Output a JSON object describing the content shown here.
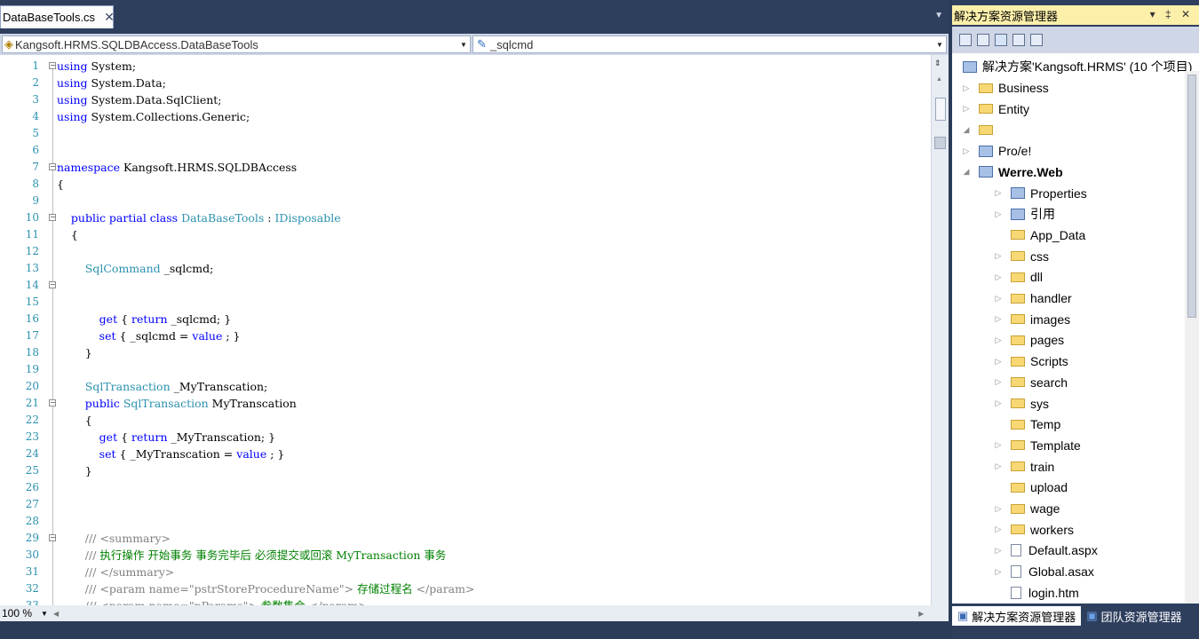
{
  "editor": {
    "tab_title": "DataBaseTools.cs",
    "tab_close": "✕",
    "type_combo": "Kangsoft.HRMS.SQLDBAccess.DataBaseTools",
    "member_combo": "_sqlcmd",
    "zoom": "100 %",
    "lines": [
      {
        "n": "1",
        "parts": [
          [
            "kw",
            "using"
          ],
          [
            "",
            "System;"
          ]
        ],
        "fold": "−"
      },
      {
        "n": "2",
        "parts": [
          [
            "kw",
            "using"
          ],
          [
            "",
            "System.Data;"
          ]
        ]
      },
      {
        "n": "3",
        "parts": [
          [
            "kw",
            "using"
          ],
          [
            "",
            "System.Data.SqlClient;"
          ]
        ]
      },
      {
        "n": "4",
        "parts": [
          [
            "kw",
            "using"
          ],
          [
            "",
            "System.Collections.Generic;"
          ]
        ]
      },
      {
        "n": "5",
        "parts": []
      },
      {
        "n": "6",
        "parts": []
      },
      {
        "n": "7",
        "parts": [
          [
            "kw",
            "namespace"
          ],
          [
            "",
            "Kangsoft.HRMS.SQLDBAccess"
          ]
        ],
        "fold": "−"
      },
      {
        "n": "8",
        "parts": [
          [
            "",
            "{"
          ]
        ]
      },
      {
        "n": "9",
        "parts": []
      },
      {
        "n": "10",
        "parts": [
          [
            "kw",
            "    public partial class"
          ],
          [
            "ty",
            "DataBaseTools"
          ],
          [
            "",
            ":"
          ],
          [
            "ty",
            "IDisposable"
          ]
        ],
        "fold": "−"
      },
      {
        "n": "11",
        "parts": [
          [
            "",
            "    {"
          ]
        ]
      },
      {
        "n": "12",
        "parts": []
      },
      {
        "n": "13",
        "parts": [
          [
            "ty",
            "        SqlCommand"
          ],
          [
            "",
            "_sqlcmd;"
          ]
        ]
      },
      {
        "n": "14",
        "parts": [],
        "fold": "−"
      },
      {
        "n": "15",
        "parts": []
      },
      {
        "n": "16",
        "parts": [
          [
            "kw",
            "            get"
          ],
          [
            "",
            "{"
          ],
          [
            "kw",
            "return"
          ],
          [
            "",
            "_sqlcmd; }"
          ]
        ]
      },
      {
        "n": "17",
        "parts": [
          [
            "kw",
            "            set"
          ],
          [
            "",
            "{ _sqlcmd ="
          ],
          [
            "kw",
            "value"
          ],
          [
            "",
            "; }"
          ]
        ]
      },
      {
        "n": "18",
        "parts": [
          [
            "",
            "        }"
          ]
        ]
      },
      {
        "n": "19",
        "parts": []
      },
      {
        "n": "20",
        "parts": [
          [
            "ty",
            "        SqlTransaction"
          ],
          [
            "",
            "_MyTranscation;"
          ]
        ]
      },
      {
        "n": "21",
        "parts": [
          [
            "kw",
            "        public"
          ],
          [
            "ty",
            "SqlTransaction"
          ],
          [
            "",
            "MyTranscation"
          ]
        ],
        "fold": "−"
      },
      {
        "n": "22",
        "parts": [
          [
            "",
            "        {"
          ]
        ]
      },
      {
        "n": "23",
        "parts": [
          [
            "kw",
            "            get"
          ],
          [
            "",
            "{"
          ],
          [
            "kw",
            "return"
          ],
          [
            "",
            "_MyTranscation; }"
          ]
        ]
      },
      {
        "n": "24",
        "parts": [
          [
            "kw",
            "            set"
          ],
          [
            "",
            "{ _MyTranscation ="
          ],
          [
            "kw",
            "value"
          ],
          [
            "",
            "; }"
          ]
        ]
      },
      {
        "n": "25",
        "parts": [
          [
            "",
            "        }"
          ]
        ]
      },
      {
        "n": "26",
        "parts": []
      },
      {
        "n": "27",
        "parts": []
      },
      {
        "n": "28",
        "parts": []
      },
      {
        "n": "29",
        "parts": [
          [
            "dc",
            "        ///"
          ],
          [
            "dc",
            "<summary>"
          ]
        ],
        "fold": "−"
      },
      {
        "n": "30",
        "parts": [
          [
            "dc",
            "        ///"
          ],
          [
            "cm",
            "执行操作 开始事务 事务完毕后 必须提交或回滚 MyTransaction 事务"
          ]
        ]
      },
      {
        "n": "31",
        "parts": [
          [
            "dc",
            "        ///"
          ],
          [
            "dc",
            "</summary>"
          ]
        ]
      },
      {
        "n": "32",
        "parts": [
          [
            "dc",
            "        ///"
          ],
          [
            "dc",
            "<param name=\"pstrStoreProcedureName\">"
          ],
          [
            "cm",
            "存储过程名"
          ],
          [
            "dc",
            "</param>"
          ]
        ]
      },
      {
        "n": "33",
        "parts": [
          [
            "dc",
            "        ///"
          ],
          [
            "dc",
            "<param name=\"pParams\">"
          ],
          [
            "cm",
            "参数集合"
          ],
          [
            "dc",
            "</param>"
          ]
        ]
      }
    ]
  },
  "explorer": {
    "title": "解决方案资源管理器",
    "title_controls": "▾ ‡ ✕",
    "solution": "解决方案'Kangsoft.HRMS' (10 个项目)",
    "items": [
      {
        "label": "Business",
        "kind": "folder",
        "level": 0,
        "arrow": "▷"
      },
      {
        "label": "Entity",
        "kind": "folder",
        "level": 0,
        "arrow": "▷"
      },
      {
        "label": "",
        "kind": "folder",
        "level": 0,
        "arrow": "◢"
      },
      {
        "label": "Pro/e!",
        "kind": "proj",
        "level": 0,
        "arrow": "▷"
      },
      {
        "label": "Werre.Web",
        "kind": "proj",
        "level": 0,
        "arrow": "◢",
        "bold": true
      },
      {
        "label": "Properties",
        "kind": "proj",
        "level": 1,
        "arrow": "▷"
      },
      {
        "label": "引用",
        "kind": "proj",
        "level": 1,
        "arrow": "▷"
      },
      {
        "label": "App_Data",
        "kind": "folder",
        "level": 1,
        "arrow": ""
      },
      {
        "label": "css",
        "kind": "folder",
        "level": 1,
        "arrow": "▷"
      },
      {
        "label": "dll",
        "kind": "folder",
        "level": 1,
        "arrow": "▷"
      },
      {
        "label": "handler",
        "kind": "folder",
        "level": 1,
        "arrow": "▷"
      },
      {
        "label": "images",
        "kind": "folder",
        "level": 1,
        "arrow": "▷"
      },
      {
        "label": "pages",
        "kind": "folder",
        "level": 1,
        "arrow": "▷"
      },
      {
        "label": "Scripts",
        "kind": "folder",
        "level": 1,
        "arrow": "▷"
      },
      {
        "label": "search",
        "kind": "folder",
        "level": 1,
        "arrow": "▷"
      },
      {
        "label": "sys",
        "kind": "folder",
        "level": 1,
        "arrow": "▷"
      },
      {
        "label": "Temp",
        "kind": "folder",
        "level": 1,
        "arrow": ""
      },
      {
        "label": "Template",
        "kind": "folder",
        "level": 1,
        "arrow": "▷"
      },
      {
        "label": "train",
        "kind": "folder",
        "level": 1,
        "arrow": "▷"
      },
      {
        "label": "upload",
        "kind": "folder",
        "level": 1,
        "arrow": ""
      },
      {
        "label": "wage",
        "kind": "folder",
        "level": 1,
        "arrow": "▷"
      },
      {
        "label": "workers",
        "kind": "folder",
        "level": 1,
        "arrow": "▷"
      },
      {
        "label": "Default.aspx",
        "kind": "file",
        "level": 1,
        "arrow": "▷"
      },
      {
        "label": "Global.asax",
        "kind": "file",
        "level": 1,
        "arrow": "▷"
      },
      {
        "label": "login.htm",
        "kind": "file",
        "level": 1,
        "arrow": ""
      }
    ],
    "bottom_tabs": [
      "解决方案资源管理器",
      "团队资源管理器"
    ]
  }
}
